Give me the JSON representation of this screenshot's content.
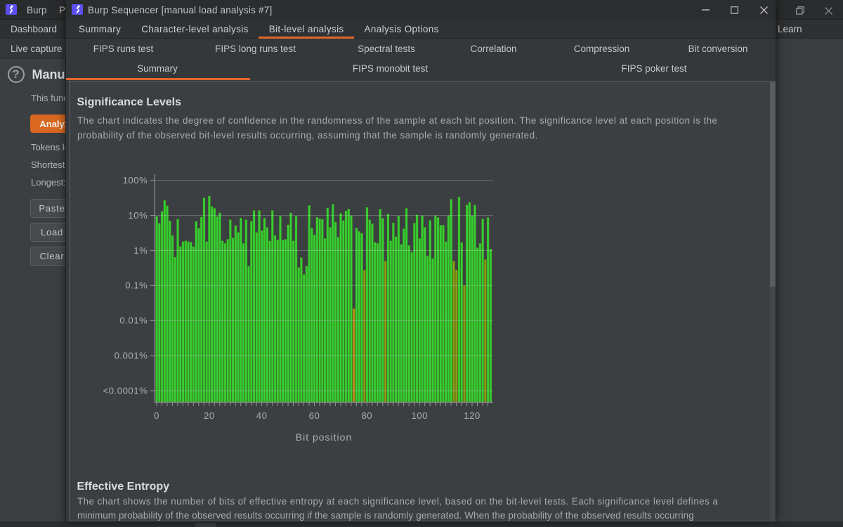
{
  "background_window": {
    "titlebar": {
      "menu_burp": "Burp",
      "menu_project": "Project"
    },
    "tab_dashboard": "Dashboard",
    "tab_learn": "Learn",
    "subtab_live_capture": "Live capture",
    "sidebar": {
      "help_icon": "?",
      "heading": "Manual load",
      "description": "This function allows you to load Sequencer with a sample of tokens that you have already obtained, and then perform the statistical analysis on the sample.",
      "analyze_button": "Analyze now",
      "labels": [
        "Tokens loaded:",
        "Shortest:",
        "Longest:"
      ],
      "buttons": [
        "Paste",
        "Load",
        "Clear"
      ]
    }
  },
  "dialog": {
    "title": "Burp Sequencer [manual load analysis #7]",
    "tabs": [
      "Summary",
      "Character-level analysis",
      "Bit-level analysis",
      "Analysis Options"
    ],
    "selected_tab": "Bit-level analysis",
    "subtabs_row1": [
      "FIPS runs test",
      "FIPS long runs test",
      "Spectral tests",
      "Correlation",
      "Compression",
      "Bit conversion"
    ],
    "subtabs_row2": [
      "Summary",
      "FIPS monobit test",
      "FIPS poker test"
    ],
    "selected_subtab": "Summary",
    "section1": {
      "heading": "Significance Levels",
      "line1": "The chart indicates the degree of confidence in the randomness of the sample at each bit position. The significance level at each position is the",
      "line2": "probability of the observed bit-level results occurring, assuming that the sample is randomly generated."
    },
    "section2": {
      "heading": "Effective Entropy",
      "line1": "The chart shows the number of bits of effective entropy at each significance level, based on the bit-level tests. Each significance level defines a",
      "line2": "minimum probability of the observed results occurring if the sample is randomly generated. When the probability of the observed results occurring"
    }
  },
  "chart_data": {
    "type": "bar",
    "title": "Significance Levels",
    "xlabel": "Bit position",
    "ylabel": "",
    "y_scale": "log",
    "y_tick_labels": [
      "100%",
      "10%",
      "1%",
      "0.1%",
      "0.01%",
      "0.001%",
      "<0.0001%"
    ],
    "y_tick_values": [
      100,
      10,
      1,
      0.1,
      0.01,
      0.001,
      0.0001
    ],
    "x_tick_labels": [
      "0",
      "20",
      "40",
      "60",
      "80",
      "100",
      "120"
    ],
    "x_tick_values": [
      0,
      20,
      40,
      60,
      80,
      100,
      120
    ],
    "x_range": [
      0,
      128
    ],
    "grid": "horizontal",
    "legend": "none",
    "bar_color": "#34d034",
    "olive_color": "#8e9a15",
    "amber_color": "#c18a18",
    "olive_bars": [
      79,
      87,
      113,
      114,
      117,
      125
    ],
    "amber_bars": [
      75
    ],
    "values": [
      9.5,
      6,
      13,
      27,
      19,
      7,
      2.7,
      0.65,
      7.9,
      1.3,
      1.8,
      1.9,
      1.8,
      1.75,
      1.3,
      6.8,
      4.3,
      9,
      32,
      1.8,
      36,
      18,
      16,
      9.3,
      12,
      1.9,
      1.6,
      2.1,
      7.6,
      2.3,
      5.2,
      3.3,
      8.5,
      1.6,
      7.6,
      0.36,
      6.8,
      13.9,
      3.3,
      13.9,
      3.7,
      8.5,
      4.6,
      1.9,
      13.9,
      2.7,
      2,
      9.5,
      2,
      2.1,
      5.4,
      11.9,
      1.9,
      9.5,
      0.33,
      0.63,
      0.21,
      0.36,
      19.4,
      4.3,
      2.8,
      8.9,
      8.1,
      7.8,
      2.2,
      16.5,
      4.6,
      21,
      6.5,
      2.4,
      11.5,
      7.2,
      13.5,
      15.3,
      10,
      0.022,
      4.4,
      3.5,
      3.1,
      0.28,
      17,
      7.6,
      5.8,
      1.7,
      1.6,
      15,
      8.3,
      0.5,
      11,
      1.9,
      6.2,
      2.5,
      9.8,
      1.5,
      4.2,
      16,
      1.4,
      0.9,
      6.1,
      10.4,
      2.2,
      10,
      4.6,
      0.7,
      7.3,
      0.6,
      10,
      8.8,
      5.3,
      5.3,
      1.8,
      10,
      29,
      0.5,
      0.28,
      34,
      1.7,
      0.1,
      20,
      23.6,
      10,
      20,
      1.2,
      1.6,
      8,
      0.55,
      8.8,
      1.1
    ]
  },
  "colors": {
    "accent_orange": "#e2662c",
    "button_orange": "#d9671f",
    "panel_bg": "#3c3f41",
    "dark_bg": "#2a2b2c",
    "bar_green": "#33cc33"
  }
}
